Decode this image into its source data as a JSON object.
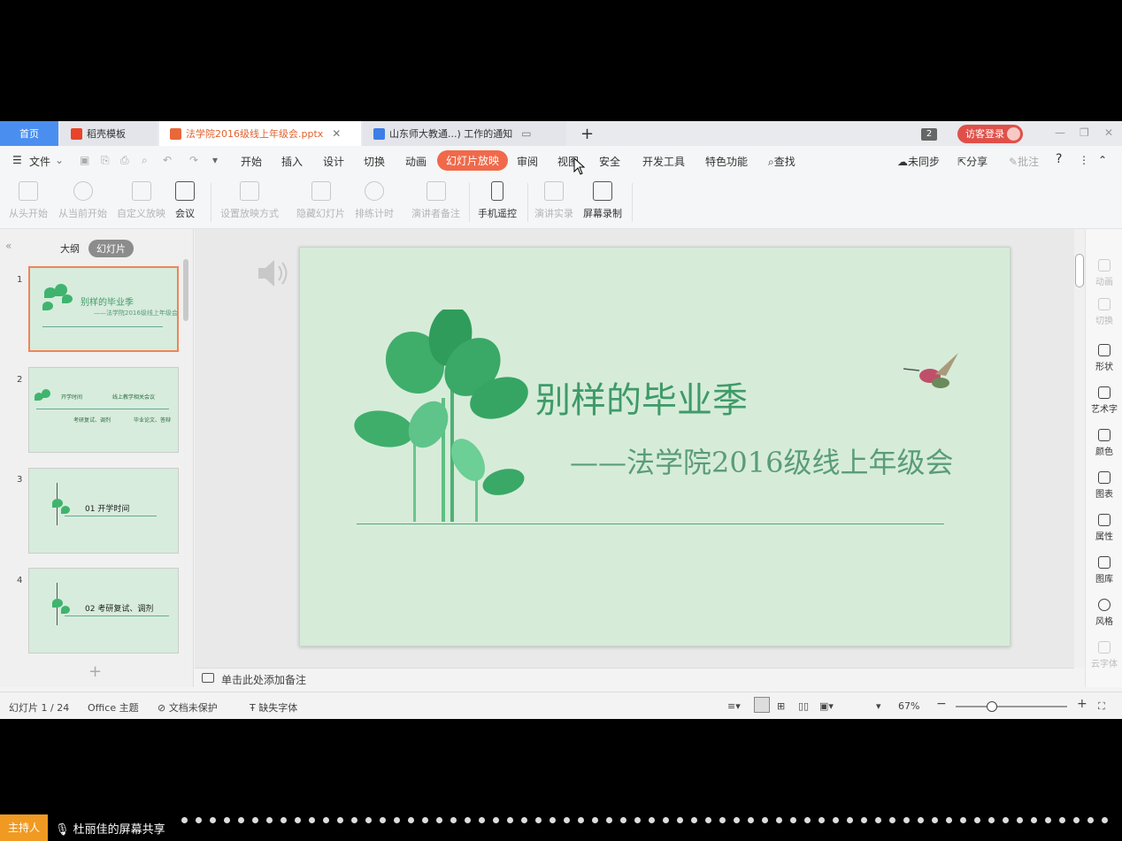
{
  "tabs": {
    "home": "首页",
    "template": "稻壳模板",
    "document": "法学院2016级线上年级会.pptx",
    "document2": "山东师大教通...) 工作的通知",
    "window_count": "2",
    "visitor_login": "访客登录"
  },
  "menu": {
    "file": "文件",
    "items": [
      "开始",
      "插入",
      "设计",
      "切换",
      "动画",
      "幻灯片放映",
      "审阅",
      "视图",
      "安全",
      "开发工具",
      "特色功能"
    ],
    "active": "幻灯片放映",
    "search": "查找",
    "sync": "未同步",
    "share": "分享",
    "comment": "批注"
  },
  "toolbar": {
    "from_start": "从头开始",
    "from_current": "从当前开始",
    "custom_show": "自定义放映",
    "meeting": "会议",
    "setup_show": "设置放映方式",
    "hide_slide": "隐藏幻灯片",
    "rehearse": "排练计时",
    "presenter_notes": "演讲者备注",
    "phone_remote": "手机遥控",
    "live_record": "演讲实录",
    "screen_record": "屏幕录制"
  },
  "left_panel": {
    "outline": "大纲",
    "slides": "幻灯片",
    "thumbs": [
      {
        "num": "1",
        "title": "别样的毕业季",
        "sub": "——法学院2016级线上年级会"
      },
      {
        "num": "2",
        "t1": "开学时间",
        "t2": "线上教学相关会议",
        "t3": "考研复试、调剂",
        "t4": "毕业论文、答辩"
      },
      {
        "num": "3",
        "title": "01  开学时间"
      },
      {
        "num": "4",
        "title": "02  考研复试、调剂"
      }
    ]
  },
  "slide": {
    "title": "别样的毕业季",
    "subtitle": "——法学院2016级线上年级会"
  },
  "notes_placeholder": "单击此处添加备注",
  "right_sidebar": [
    "动画",
    "切换",
    "形状",
    "艺术字",
    "颜色",
    "图表",
    "属性",
    "图库",
    "风格",
    "云字体"
  ],
  "status": {
    "slide_pos": "幻灯片 1 / 24",
    "theme": "Office 主题",
    "protect": "文档未保护",
    "missing_font": "缺失字体",
    "zoom": "67%"
  },
  "meeting": {
    "host": "主持人",
    "share": "杜丽佳的屏幕共享"
  },
  "colors": {
    "accent": "#f0694a",
    "slide_bg": "#d6ecd9",
    "title_green": "#3f9a68"
  }
}
